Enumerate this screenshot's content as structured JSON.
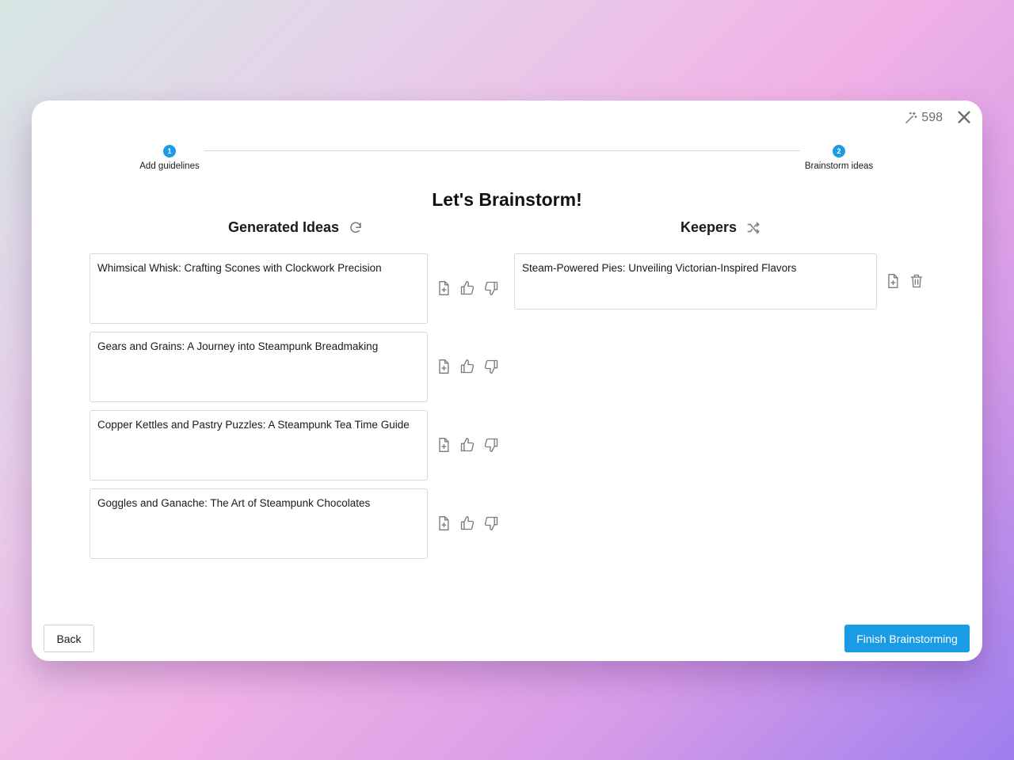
{
  "credits": {
    "value": "598",
    "icon": "magic-wand-icon"
  },
  "stepper": {
    "steps": [
      {
        "number": "1",
        "label": "Add guidelines"
      },
      {
        "number": "2",
        "label": "Brainstorm ideas"
      }
    ]
  },
  "title": "Let's Brainstorm!",
  "generated": {
    "heading": "Generated Ideas",
    "ideas": [
      "Whimsical Whisk: Crafting Scones with Clockwork Precision",
      "Gears and Grains: A Journey into Steampunk Breadmaking",
      "Copper Kettles and Pastry Puzzles: A Steampunk Tea Time Guide",
      "Goggles and Ganache: The Art of Steampunk Chocolates"
    ]
  },
  "keepers": {
    "heading": "Keepers",
    "items": [
      "Steam-Powered Pies: Unveiling Victorian-Inspired Flavors"
    ]
  },
  "footer": {
    "back_label": "Back",
    "finish_label": "Finish Brainstorming"
  },
  "colors": {
    "accent": "#1a9be6",
    "icon_gray": "#7a7a7a"
  }
}
